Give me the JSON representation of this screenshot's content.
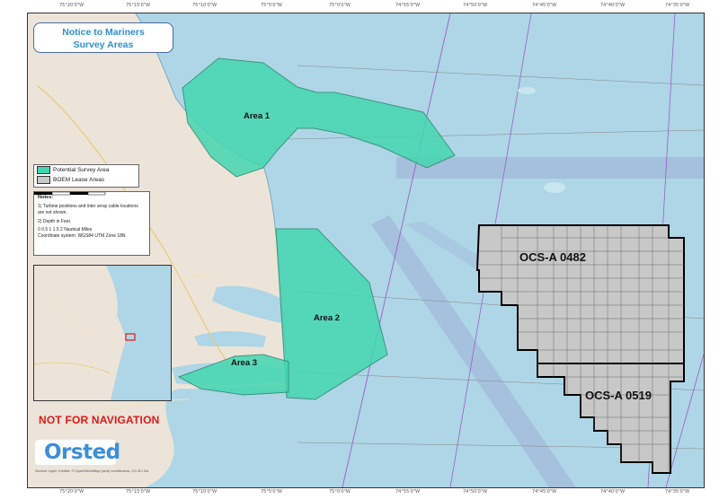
{
  "title": {
    "line1": "Notice to Mariners",
    "line2": "Survey Areas"
  },
  "legend": [
    {
      "label": "Potential Survey Area",
      "color": "#45d6b1"
    },
    {
      "label": "BOEM Lease Areas",
      "color": "#c8c8c8"
    }
  ],
  "notes": {
    "heading": "Notes:",
    "item1": "1) Turbine positions and inter array cable locations are not shown.",
    "item2": "2) Depth in Feet.",
    "scale_values": "0  0.5  1  1.5  2 Nautical Miles",
    "coordinate_system": "Coordinate system: WGS84 UTM Zone 18N"
  },
  "survey_areas": [
    {
      "label": "Area 1"
    },
    {
      "label": "Area 2"
    },
    {
      "label": "Area 3"
    }
  ],
  "lease_areas": [
    {
      "label": "OCS-A 0482"
    },
    {
      "label": "OCS-A 0519"
    }
  ],
  "warning": "NOT FOR NAVIGATION",
  "logo": "Orsted",
  "credit": "Service Layer Credits: © OpenStreetMap (and) contributors, CC-BY-SA",
  "colors": {
    "survey_fill": "#45d6b1",
    "lease_fill": "#c8c8c8",
    "water": "#aed6e6",
    "land": "#ece4d8",
    "warning": "#e01919",
    "brand": "#3a8fd8"
  },
  "icons": {
    "logo": "orsted-logo-icon",
    "inset": "locator-inset-map"
  }
}
